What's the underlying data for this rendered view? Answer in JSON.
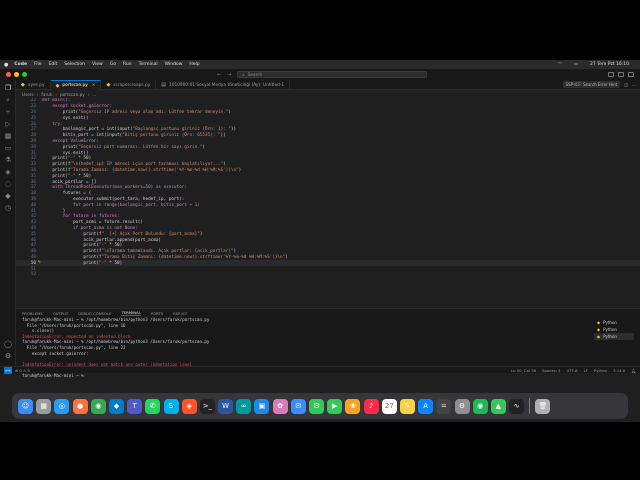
{
  "menubar": {
    "apple": "",
    "app": "Code",
    "items": [
      "File",
      "Edit",
      "Selection",
      "View",
      "Go",
      "Run",
      "Terminal",
      "Window",
      "Help"
    ],
    "clock": "27 Tem Pzt 16:10"
  },
  "window": {
    "search_placeholder": "Search"
  },
  "tabs": [
    {
      "label": "ayes.py",
      "active": false
    },
    {
      "label": "portscan.py",
      "active": true
    },
    {
      "label": "scrapercroaps.py",
      "active": false
    },
    {
      "label": "1010900:01 Sosyal Medya Yöneticiliği (Ay): Untitled-1",
      "active": false
    }
  ],
  "tabs_right": "SSP-ICF: Search Error Hint",
  "breadcrumb": [
    "Users",
    "faruk",
    "portscan.py",
    "..."
  ],
  "editor": {
    "lines": [
      {
        "n": "22",
        "code": "def main():"
      },
      {
        "n": "23",
        "code": "    except socket.gaierror:"
      },
      {
        "n": "24",
        "code": "        print(\"Geçersiz IP adresi veya alan adı. Lütfen tekrar deneyin.\")"
      },
      {
        "n": "25",
        "code": "        sys.exit()"
      },
      {
        "n": "26",
        "code": "    try:"
      },
      {
        "n": "27",
        "code": "        baslangic_port = int(input(\"Başlangıç portunu giriniz (Örn: 1): \"))"
      },
      {
        "n": "28",
        "code": "        bitis_port = int(input(\"Bitiş portunu giriniz (Örn: 65535): \"))"
      },
      {
        "n": "29",
        "code": "    except ValueError:"
      },
      {
        "n": "30",
        "code": "        print(\"Geçersiz port numarası. Lütfen bir sayı girin.\")"
      },
      {
        "n": "31",
        "code": "        sys.exit()"
      },
      {
        "n": "32",
        "code": "    print(\"-\" * 50)"
      },
      {
        "n": "33",
        "code": "    print(f\"\\n{hedef_ip} IP adresi için port taraması başlatılıyor...\")"
      },
      {
        "n": "34",
        "code": "    print(f\"Tarama Zamanı: {datetime.now().strftime('%Y-%m-%d %H:%M:%S')}\\n\")"
      },
      {
        "n": "35",
        "code": "    print(\"-\" * 50)"
      },
      {
        "n": "36",
        "code": "    acik_portlar = []"
      },
      {
        "n": "37",
        "code": "    with ThreadPoolExecutor(max_workers=50) as executor:"
      },
      {
        "n": "38",
        "code": "        futures = {"
      },
      {
        "n": "39",
        "code": "            executor.submit(port_tara, hedef_ip, port):"
      },
      {
        "n": "40",
        "code": "            for port in range(baslangic_port, bitis_port + 1)"
      },
      {
        "n": "41",
        "code": "        }"
      },
      {
        "n": "42",
        "code": "        for future in futures:"
      },
      {
        "n": "43",
        "code": "            port_acmi = future.result()"
      },
      {
        "n": "44",
        "code": "            if port_acma is not None:"
      },
      {
        "n": "45",
        "code": "                print(f\"  [+] Açık Port Bulundu: {port_acma}\")"
      },
      {
        "n": "46",
        "code": "                acik_portlar.append(port_acma)"
      },
      {
        "n": "47",
        "code": "                print(\"-\" * 50)"
      },
      {
        "n": "48",
        "code": "                print(f\"\\nTarama tamamlandı. Açık portlar: {acik_portlar}\")"
      },
      {
        "n": "49",
        "code": "                print(f\"Tarama Bitiş Zamanı: {datetime.now().strftime('%Y-%m-%d %H:%M:%S')}\\n\")"
      },
      {
        "n": "50",
        "code": "                print(\"-\" * 50)"
      },
      {
        "n": "51",
        "code": ""
      },
      {
        "n": "52",
        "code": ""
      }
    ]
  },
  "panel": {
    "tabs": [
      "PROBLEMS",
      "OUTPUT",
      "DEBUG CONSOLE",
      "TERMINAL",
      "PORTS",
      "SSP-ICF"
    ],
    "terminal": [
      {
        "t": "faruk@farukk-Mac-mini ~ % /opt/homebrew/bin/python3 /Users/faruk/portscan.py",
        "err": false
      },
      {
        "t": "  File \"/Users/faruk/portscan.py\", line 16",
        "err": false
      },
      {
        "t": "    s.close()",
        "err": false
      },
      {
        "t": "IndentationError: expected an indented block",
        "err": true
      },
      {
        "t": "faruk@farukk-Mac-mini ~ % /opt/homebrew/bin/python3 /Users/faruk/portscan.py",
        "err": false
      },
      {
        "t": "  File \"/Users/faruk/portscan.py\", line 23",
        "err": false
      },
      {
        "t": "    except socket.gaierror:",
        "err": false
      },
      {
        "t": "",
        "err": false
      },
      {
        "t": "IndentationError: unindent does not match any outer indentation level",
        "err": true
      },
      {
        "t": "faruk@farukk-Mac-mini ~ % /opt/homebrew/bin/python3 /Users/faruk/portscan.py",
        "err": false
      },
      {
        "t": "faruk@farukk-Mac-mini ~ % ",
        "err": false
      }
    ],
    "terminals": [
      "Python",
      "Python",
      "Python"
    ]
  },
  "status": {
    "position": "Ln 50, Col 36",
    "spaces": "Spaces: 4",
    "encoding": "UTF-8",
    "eol": "LF",
    "language": "Python",
    "version": "3.14.0"
  },
  "dock_icons": [
    "finder-icon",
    "launchpad-icon",
    "safari-icon",
    "firefox-icon",
    "chrome-icon",
    "vscode-icon",
    "teams-icon",
    "whatsapp-icon",
    "skype-icon",
    "brave-icon",
    "terminal-icon",
    "word-icon",
    "arduino-icon",
    "vmware-icon",
    "photo-icon",
    "mail-icon",
    "messages-icon",
    "facetime-icon",
    "photos-icon",
    "music-icon",
    "calendar-icon",
    "notes-icon",
    "appstore-icon",
    "calculator-icon",
    "settings-icon",
    "spotify-icon",
    "maps-icon",
    "activity-icon",
    "trash-icon"
  ],
  "colors": {
    "accent": "#0078d4",
    "error": "#f14c4c"
  }
}
